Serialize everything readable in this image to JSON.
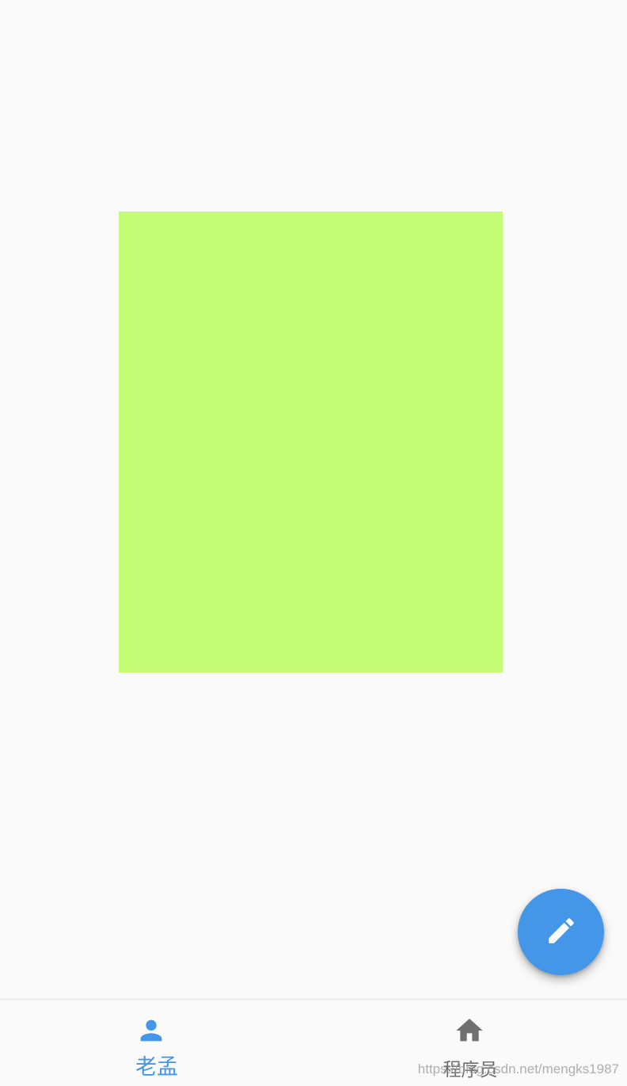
{
  "colors": {
    "background": "#fafafa",
    "content_box": "#c4fd75",
    "accent": "#4496e8",
    "inactive": "#707070",
    "fab_icon": "#ffffff"
  },
  "fab": {
    "icon": "edit-pencil-icon"
  },
  "bottom_nav": {
    "items": [
      {
        "label": "老孟",
        "icon": "person-icon",
        "active": true
      },
      {
        "label": "程序员",
        "icon": "home-icon",
        "active": false
      }
    ]
  },
  "watermark": {
    "text": "https://blog.csdn.net/mengks1987"
  }
}
